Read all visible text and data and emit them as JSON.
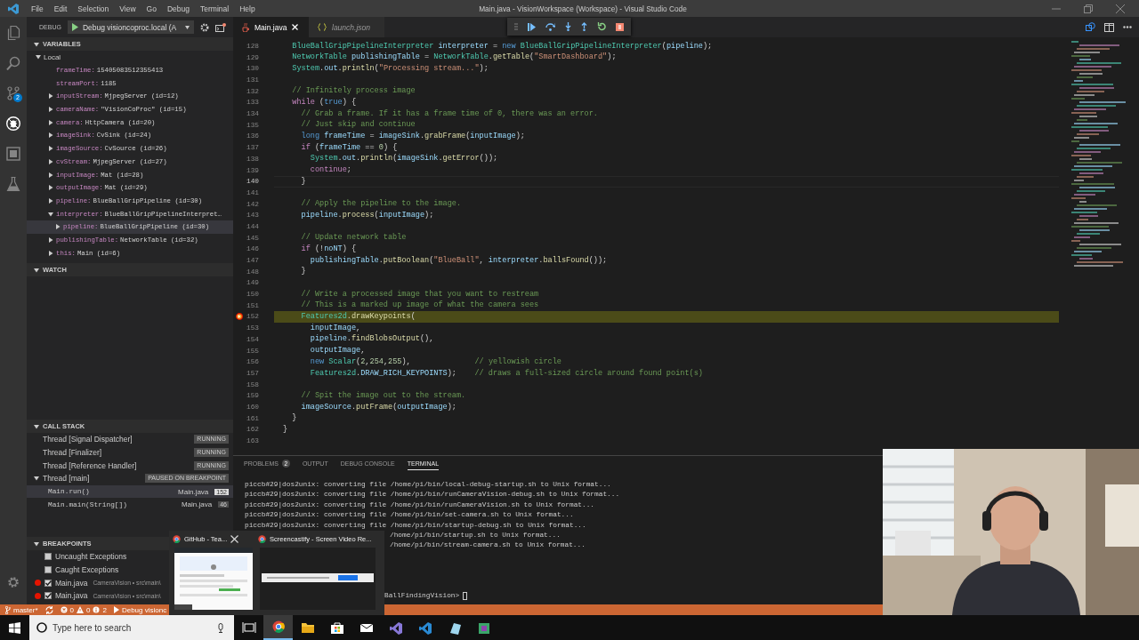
{
  "title_bar": {
    "menu": [
      "File",
      "Edit",
      "Selection",
      "View",
      "Go",
      "Debug",
      "Terminal",
      "Help"
    ],
    "title": "Main.java - VisionWorkspace (Workspace) - Visual Studio Code"
  },
  "activity_bar": [
    {
      "kind": "explorer",
      "selected": false
    },
    {
      "kind": "search",
      "selected": false
    },
    {
      "kind": "scm",
      "selected": false,
      "badge": "2"
    },
    {
      "kind": "debug",
      "selected": true
    },
    {
      "kind": "extensions",
      "selected": false
    },
    {
      "kind": "test",
      "selected": false
    }
  ],
  "debug_toolbar": {
    "label": "DEBUG",
    "configuration": "Debug visioncoproc.local (A"
  },
  "variables": {
    "title": "VARIABLES",
    "expanded": true,
    "scopes": [
      {
        "name": "Local",
        "expanded": true,
        "children": [
          {
            "name": "frameTime:",
            "value": "15405083512355413",
            "selected": false
          },
          {
            "name": "streamPort:",
            "value": "1185",
            "selected": false
          },
          {
            "name": "inputStream:",
            "value": "MjpegServer (id=12)",
            "expanded": false,
            "selected": false
          },
          {
            "name": "cameraName:",
            "value": "\"VisionCoProc\" (id=15)",
            "expanded": false,
            "selected": false
          },
          {
            "name": "camera:",
            "value": "HttpCamera (id=20)",
            "expanded": false,
            "selected": false
          },
          {
            "name": "imageSink:",
            "value": "CvSink (id=24)",
            "expanded": false,
            "selected": false
          },
          {
            "name": "imageSource:",
            "value": "CvSource (id=26)",
            "expanded": false,
            "selected": false
          },
          {
            "name": "cvStream:",
            "value": "MjpegServer (id=27)",
            "expanded": false,
            "selected": false
          },
          {
            "name": "inputImage:",
            "value": "Mat (id=28)",
            "expanded": false,
            "selected": false
          },
          {
            "name": "outputImage:",
            "value": "Mat (id=29)",
            "expanded": false,
            "selected": false
          },
          {
            "name": "pipeline:",
            "value": "BlueBallGripPipeline (id=30)",
            "expanded": false,
            "selected": false
          },
          {
            "name": "interpreter:",
            "value": "BlueBallGripPipelineInterpret…",
            "expanded": true,
            "selected": false,
            "children": [
              {
                "name": "pipeline:",
                "value": "BlueBallGripPipeline (id=30)",
                "expanded": false,
                "selected": true
              }
            ]
          },
          {
            "name": "publishingTable:",
            "value": "NetworkTable (id=32)",
            "expanded": false,
            "selected": false
          },
          {
            "name": "this:",
            "value": "Main (id=6)",
            "expanded": false,
            "selected": false
          }
        ]
      }
    ]
  },
  "watch": {
    "title": "WATCH",
    "expanded": true
  },
  "call_stack": {
    "title": "CALL STACK",
    "expanded": true,
    "threads": [
      {
        "name": "Thread [Signal Dispatcher]",
        "status": "RUNNING"
      },
      {
        "name": "Thread [Finalizer]",
        "status": "RUNNING"
      },
      {
        "name": "Thread [Reference Handler]",
        "status": "RUNNING"
      },
      {
        "name": "Thread [main]",
        "status": "PAUSED ON BREAKPOINT",
        "expanded": true,
        "frames": [
          {
            "name": "Main.run()",
            "file": "Main.java",
            "line": "152",
            "selected": true
          },
          {
            "name": "Main.main(String[])",
            "file": "Main.java",
            "line": "46",
            "selected": false
          }
        ]
      }
    ]
  },
  "breakpoints": {
    "title": "BREAKPOINTS",
    "expanded": true,
    "items": [
      {
        "kind": "exception",
        "label": "Uncaught Exceptions",
        "checked": false
      },
      {
        "kind": "exception",
        "label": "Caught Exceptions",
        "checked": false
      },
      {
        "kind": "line",
        "label": "Main.java",
        "detail": "CameraVision • src\\main\\",
        "checked": true
      },
      {
        "kind": "line",
        "label": "Main.java",
        "detail": "CameraVision • src\\main\\",
        "checked": true
      }
    ]
  },
  "editor": {
    "tabs": [
      {
        "label": "Main.java",
        "kind": "java",
        "selected": true,
        "preview": false
      },
      {
        "label": "launch.json",
        "kind": "json",
        "selected": false,
        "preview": true
      }
    ],
    "lines": [
      {
        "n": "128",
        "code": [
          {
            "kind": "type",
            "text": "  BlueBallGripPipelineInterpreter"
          },
          {
            "kind": "var",
            "text": " interpreter"
          },
          {
            "kind": "plain",
            "text": " = "
          },
          {
            "kind": "kw",
            "text": "new"
          },
          {
            "kind": "type",
            "text": " BlueBallGripPipelineInterpreter"
          },
          {
            "kind": "plain",
            "text": "("
          },
          {
            "kind": "var",
            "text": "pipeline"
          },
          {
            "kind": "plain",
            "text": ");"
          }
        ]
      },
      {
        "n": "129",
        "code": [
          {
            "kind": "type",
            "text": "  NetworkTable"
          },
          {
            "kind": "var",
            "text": " publishingTable"
          },
          {
            "kind": "plain",
            "text": " = "
          },
          {
            "kind": "type",
            "text": "NetworkTable"
          },
          {
            "kind": "plain",
            "text": "."
          },
          {
            "kind": "func",
            "text": "getTable"
          },
          {
            "kind": "plain",
            "text": "("
          },
          {
            "kind": "str",
            "text": "\"SmartDashboard\""
          },
          {
            "kind": "plain",
            "text": ");"
          }
        ]
      },
      {
        "n": "130",
        "code": [
          {
            "kind": "type",
            "text": "  System"
          },
          {
            "kind": "plain",
            "text": "."
          },
          {
            "kind": "var",
            "text": "out"
          },
          {
            "kind": "plain",
            "text": "."
          },
          {
            "kind": "func",
            "text": "println"
          },
          {
            "kind": "plain",
            "text": "("
          },
          {
            "kind": "str",
            "text": "\"Processing stream...\""
          },
          {
            "kind": "plain",
            "text": ");"
          }
        ]
      },
      {
        "n": "131"
      },
      {
        "n": "132",
        "code": [
          {
            "kind": "com",
            "text": "  // Infinitely process image"
          }
        ]
      },
      {
        "n": "133",
        "code": [
          {
            "kind": "ctrl",
            "text": "  while"
          },
          {
            "kind": "plain",
            "text": " ("
          },
          {
            "kind": "kw",
            "text": "true"
          },
          {
            "kind": "plain",
            "text": ") {"
          }
        ]
      },
      {
        "n": "134",
        "code": [
          {
            "kind": "com",
            "text": "    // Grab a frame. If it has a frame time of 0, there was an error."
          }
        ]
      },
      {
        "n": "135",
        "code": [
          {
            "kind": "com",
            "text": "    // Just skip and continue"
          }
        ]
      },
      {
        "n": "136",
        "code": [
          {
            "kind": "kw",
            "text": "    long"
          },
          {
            "kind": "var",
            "text": " frameTime"
          },
          {
            "kind": "plain",
            "text": " = "
          },
          {
            "kind": "var",
            "text": "imageSink"
          },
          {
            "kind": "plain",
            "text": "."
          },
          {
            "kind": "func",
            "text": "grabFrame"
          },
          {
            "kind": "plain",
            "text": "("
          },
          {
            "kind": "var",
            "text": "inputImage"
          },
          {
            "kind": "plain",
            "text": ");"
          }
        ]
      },
      {
        "n": "137",
        "code": [
          {
            "kind": "ctrl",
            "text": "    if"
          },
          {
            "kind": "plain",
            "text": " ("
          },
          {
            "kind": "var",
            "text": "frameTime"
          },
          {
            "kind": "plain",
            "text": " == "
          },
          {
            "kind": "num",
            "text": "0"
          },
          {
            "kind": "plain",
            "text": ") {"
          }
        ]
      },
      {
        "n": "138",
        "code": [
          {
            "kind": "type",
            "text": "      System"
          },
          {
            "kind": "plain",
            "text": "."
          },
          {
            "kind": "var",
            "text": "out"
          },
          {
            "kind": "plain",
            "text": "."
          },
          {
            "kind": "func",
            "text": "println"
          },
          {
            "kind": "plain",
            "text": "("
          },
          {
            "kind": "var",
            "text": "imageSink"
          },
          {
            "kind": "plain",
            "text": "."
          },
          {
            "kind": "func",
            "text": "getError"
          },
          {
            "kind": "plain",
            "text": "());"
          }
        ]
      },
      {
        "n": "139",
        "code": [
          {
            "kind": "ctrl",
            "text": "      continue"
          },
          {
            "kind": "plain",
            "text": ";"
          }
        ]
      },
      {
        "n": "140",
        "code": [
          {
            "kind": "plain",
            "text": "    }"
          }
        ],
        "cursor": true
      },
      {
        "n": "141"
      },
      {
        "n": "142",
        "code": [
          {
            "kind": "com",
            "text": "    // Apply the pipeline to the image."
          }
        ]
      },
      {
        "n": "143",
        "code": [
          {
            "kind": "var",
            "text": "    pipeline"
          },
          {
            "kind": "plain",
            "text": "."
          },
          {
            "kind": "func",
            "text": "process"
          },
          {
            "kind": "plain",
            "text": "("
          },
          {
            "kind": "var",
            "text": "inputImage"
          },
          {
            "kind": "plain",
            "text": ");"
          }
        ]
      },
      {
        "n": "144"
      },
      {
        "n": "145",
        "code": [
          {
            "kind": "com",
            "text": "    // Update network table"
          }
        ]
      },
      {
        "n": "146",
        "code": [
          {
            "kind": "ctrl",
            "text": "    if"
          },
          {
            "kind": "plain",
            "text": " (!"
          },
          {
            "kind": "var",
            "text": "noNT"
          },
          {
            "kind": "plain",
            "text": ") {"
          }
        ]
      },
      {
        "n": "147",
        "code": [
          {
            "kind": "var",
            "text": "      publishingTable"
          },
          {
            "kind": "plain",
            "text": "."
          },
          {
            "kind": "func",
            "text": "putBoolean"
          },
          {
            "kind": "plain",
            "text": "("
          },
          {
            "kind": "str",
            "text": "\"BlueBall\""
          },
          {
            "kind": "plain",
            "text": ", "
          },
          {
            "kind": "var",
            "text": "interpreter"
          },
          {
            "kind": "plain",
            "text": "."
          },
          {
            "kind": "func",
            "text": "ballsFound"
          },
          {
            "kind": "plain",
            "text": "());"
          }
        ]
      },
      {
        "n": "148",
        "code": [
          {
            "kind": "plain",
            "text": "    }"
          }
        ]
      },
      {
        "n": "149"
      },
      {
        "n": "150",
        "code": [
          {
            "kind": "com",
            "text": "    // Write a processed image that you want to restream"
          }
        ]
      },
      {
        "n": "151",
        "code": [
          {
            "kind": "com",
            "text": "    // This is a marked up image of what the camera sees"
          }
        ]
      },
      {
        "n": "152",
        "code": [
          {
            "kind": "type",
            "text": "    Features2d"
          },
          {
            "kind": "plain",
            "text": "."
          },
          {
            "kind": "func",
            "text": "drawKeypoints"
          },
          {
            "kind": "plain",
            "text": "("
          }
        ],
        "breakpoint": true,
        "current": true
      },
      {
        "n": "153",
        "code": [
          {
            "kind": "var",
            "text": "      inputImage"
          },
          {
            "kind": "plain",
            "text": ","
          }
        ]
      },
      {
        "n": "154",
        "code": [
          {
            "kind": "var",
            "text": "      pipeline"
          },
          {
            "kind": "plain",
            "text": "."
          },
          {
            "kind": "func",
            "text": "findBlobsOutput"
          },
          {
            "kind": "plain",
            "text": "(),"
          }
        ]
      },
      {
        "n": "155",
        "code": [
          {
            "kind": "var",
            "text": "      outputImage"
          },
          {
            "kind": "plain",
            "text": ","
          }
        ]
      },
      {
        "n": "156",
        "code": [
          {
            "kind": "kw",
            "text": "      new"
          },
          {
            "kind": "type",
            "text": " Scalar"
          },
          {
            "kind": "plain",
            "text": "("
          },
          {
            "kind": "num",
            "text": "2"
          },
          {
            "kind": "plain",
            "text": ","
          },
          {
            "kind": "num",
            "text": "254"
          },
          {
            "kind": "plain",
            "text": ","
          },
          {
            "kind": "num",
            "text": "255"
          },
          {
            "kind": "plain",
            "text": "),"
          },
          {
            "kind": "com",
            "text": "              // yellowish circle"
          }
        ]
      },
      {
        "n": "157",
        "code": [
          {
            "kind": "type",
            "text": "      Features2d"
          },
          {
            "kind": "plain",
            "text": "."
          },
          {
            "kind": "var",
            "text": "DRAW_RICH_KEYPOINTS"
          },
          {
            "kind": "plain",
            "text": ");"
          },
          {
            "kind": "com",
            "text": "    // draws a full-sized circle around found point(s)"
          }
        ]
      },
      {
        "n": "158"
      },
      {
        "n": "159",
        "code": [
          {
            "kind": "com",
            "text": "    // Spit the image out to the stream."
          }
        ]
      },
      {
        "n": "160",
        "code": [
          {
            "kind": "var",
            "text": "    imageSource"
          },
          {
            "kind": "plain",
            "text": "."
          },
          {
            "kind": "func",
            "text": "putFrame"
          },
          {
            "kind": "plain",
            "text": "("
          },
          {
            "kind": "var",
            "text": "outputImage"
          },
          {
            "kind": "plain",
            "text": ");"
          }
        ]
      },
      {
        "n": "161",
        "code": [
          {
            "kind": "plain",
            "text": "  }"
          }
        ]
      },
      {
        "n": "162",
        "code": [
          {
            "kind": "plain",
            "text": "}"
          }
        ]
      },
      {
        "n": "163"
      }
    ]
  },
  "panel": {
    "tabs": [
      {
        "label": "PROBLEMS",
        "badge": "2",
        "selected": false
      },
      {
        "label": "OUTPUT",
        "selected": false
      },
      {
        "label": "DEBUG CONSOLE",
        "selected": false
      },
      {
        "label": "TERMINAL",
        "selected": true
      }
    ],
    "terminal": [
      {
        "kind": "full",
        "text": "piccb#29|dos2unix: converting file /home/pi/bin/local-debug-startup.sh to Unix format..."
      },
      {
        "kind": "full",
        "text": "piccb#29|dos2unix: converting file /home/pi/bin/runCameraVision-debug.sh to Unix format..."
      },
      {
        "kind": "full",
        "text": "piccb#29|dos2unix: converting file /home/pi/bin/runCameraVision.sh to Unix format..."
      },
      {
        "kind": "full",
        "text": "piccb#29|dos2unix: converting file /home/pi/bin/set-camera.sh to Unix format..."
      },
      {
        "kind": "full",
        "text": "piccb#29|dos2unix: converting file /home/pi/bin/startup-debug.sh to Unix format..."
      },
      {
        "kind": "tail",
        "text": "/home/pi/bin/startup.sh to Unix format..."
      },
      {
        "kind": "tail",
        "text": "/home/pi/bin/stream-camera.sh to Unix format..."
      },
      {
        "kind": "prompt",
        "text": "BallFindingVision>"
      }
    ]
  },
  "status_bar": {
    "branch": "master*",
    "errors": "0",
    "warnings": "0",
    "infos": "2",
    "debug": "Debug visionc"
  },
  "taskbar": {
    "search_placeholder": "Type here to search",
    "apps": [
      {
        "kind": "taskview",
        "active": false
      },
      {
        "kind": "browser",
        "active": true
      },
      {
        "kind": "folder",
        "active": false
      },
      {
        "kind": "store",
        "active": false
      },
      {
        "kind": "mail",
        "active": false
      },
      {
        "kind": "vs",
        "active": false
      },
      {
        "kind": "code",
        "active": false
      },
      {
        "kind": "app",
        "active": false
      },
      {
        "kind": "app2",
        "active": false
      }
    ]
  },
  "thumbnail_popup": {
    "items": [
      {
        "title": "GitHub - Tea...",
        "closable": true,
        "kind": "page"
      },
      {
        "title": "Screencastify - Screen Video Re...",
        "kind": "bar"
      }
    ]
  }
}
